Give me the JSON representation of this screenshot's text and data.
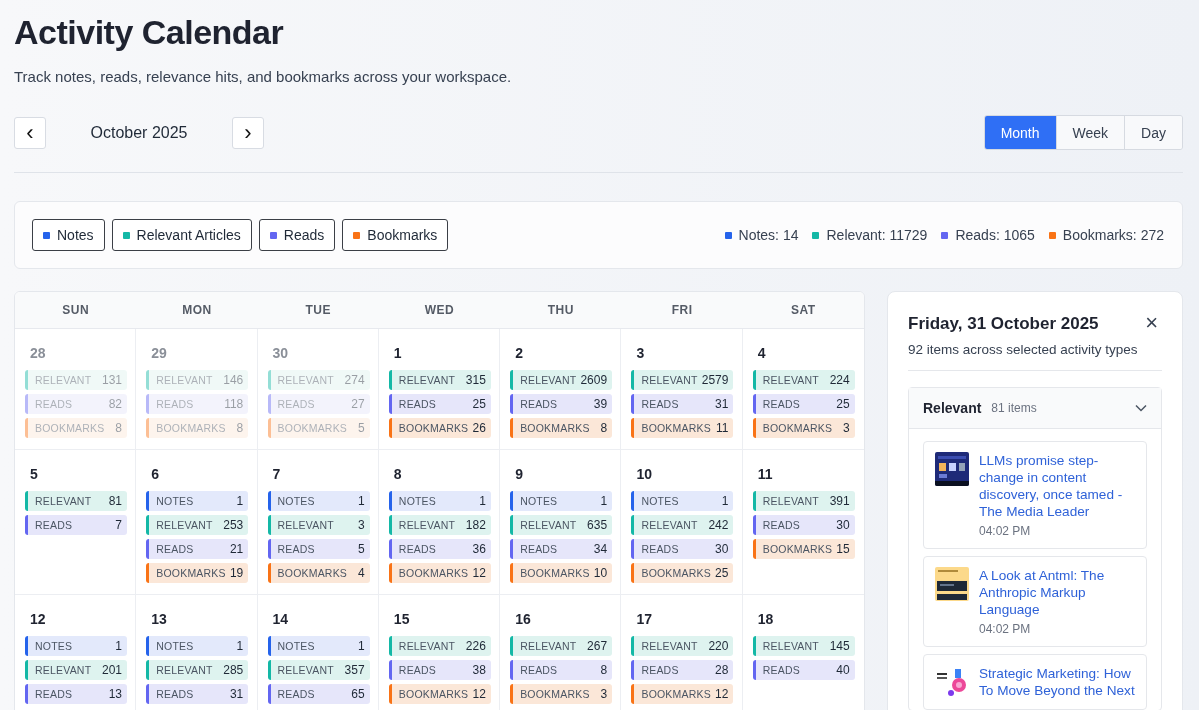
{
  "header": {
    "title": "Activity Calendar",
    "subtitle": "Track notes, reads, relevance hits, and bookmarks across your workspace."
  },
  "nav": {
    "prev": "‹",
    "month": "October 2025",
    "next": "›"
  },
  "views": [
    {
      "label": "Month",
      "selected": true
    },
    {
      "label": "Week",
      "selected": false
    },
    {
      "label": "Day",
      "selected": false
    }
  ],
  "filters": [
    {
      "label": "Notes",
      "color": "#2563eb"
    },
    {
      "label": "Relevant Articles",
      "color": "#14b8a6"
    },
    {
      "label": "Reads",
      "color": "#6366f1"
    },
    {
      "label": "Bookmarks",
      "color": "#f97316"
    }
  ],
  "totals": [
    {
      "label": "Notes: 14",
      "color": "#2563eb"
    },
    {
      "label": "Relevant: 11729",
      "color": "#14b8a6"
    },
    {
      "label": "Reads: 1065",
      "color": "#6366f1"
    },
    {
      "label": "Bookmarks: 272",
      "color": "#f97316"
    }
  ],
  "weekdays": [
    "SUN",
    "MON",
    "TUE",
    "WED",
    "THU",
    "FRI",
    "SAT"
  ],
  "weeks": [
    [
      {
        "day": "28",
        "outside": true,
        "items": [
          {
            "kind": "relevant",
            "label": "RELEVANT",
            "count": "131"
          },
          {
            "kind": "reads",
            "label": "READS",
            "count": "82"
          },
          {
            "kind": "bookmarks",
            "label": "BOOKMARKS",
            "count": "8"
          }
        ]
      },
      {
        "day": "29",
        "outside": true,
        "items": [
          {
            "kind": "relevant",
            "label": "RELEVANT",
            "count": "146"
          },
          {
            "kind": "reads",
            "label": "READS",
            "count": "118"
          },
          {
            "kind": "bookmarks",
            "label": "BOOKMARKS",
            "count": "8"
          }
        ]
      },
      {
        "day": "30",
        "outside": true,
        "items": [
          {
            "kind": "relevant",
            "label": "RELEVANT",
            "count": "274"
          },
          {
            "kind": "reads",
            "label": "READS",
            "count": "27"
          },
          {
            "kind": "bookmarks",
            "label": "BOOKMARKS",
            "count": "5"
          }
        ]
      },
      {
        "day": "1",
        "outside": false,
        "items": [
          {
            "kind": "relevant",
            "label": "RELEVANT",
            "count": "315"
          },
          {
            "kind": "reads",
            "label": "READS",
            "count": "25"
          },
          {
            "kind": "bookmarks",
            "label": "BOOKMARKS",
            "count": "26"
          }
        ]
      },
      {
        "day": "2",
        "outside": false,
        "items": [
          {
            "kind": "relevant",
            "label": "RELEVANT",
            "count": "2609"
          },
          {
            "kind": "reads",
            "label": "READS",
            "count": "39"
          },
          {
            "kind": "bookmarks",
            "label": "BOOKMARKS",
            "count": "8"
          }
        ]
      },
      {
        "day": "3",
        "outside": false,
        "items": [
          {
            "kind": "relevant",
            "label": "RELEVANT",
            "count": "2579"
          },
          {
            "kind": "reads",
            "label": "READS",
            "count": "31"
          },
          {
            "kind": "bookmarks",
            "label": "BOOKMARKS",
            "count": "11"
          }
        ]
      },
      {
        "day": "4",
        "outside": false,
        "items": [
          {
            "kind": "relevant",
            "label": "RELEVANT",
            "count": "224"
          },
          {
            "kind": "reads",
            "label": "READS",
            "count": "25"
          },
          {
            "kind": "bookmarks",
            "label": "BOOKMARKS",
            "count": "3"
          }
        ]
      }
    ],
    [
      {
        "day": "5",
        "outside": false,
        "items": [
          {
            "kind": "relevant",
            "label": "RELEVANT",
            "count": "81"
          },
          {
            "kind": "reads",
            "label": "READS",
            "count": "7"
          }
        ]
      },
      {
        "day": "6",
        "outside": false,
        "items": [
          {
            "kind": "notes",
            "label": "NOTES",
            "count": "1"
          },
          {
            "kind": "relevant",
            "label": "RELEVANT",
            "count": "253"
          },
          {
            "kind": "reads",
            "label": "READS",
            "count": "21"
          },
          {
            "kind": "bookmarks",
            "label": "BOOKMARKS",
            "count": "19"
          }
        ]
      },
      {
        "day": "7",
        "outside": false,
        "items": [
          {
            "kind": "notes",
            "label": "NOTES",
            "count": "1"
          },
          {
            "kind": "relevant",
            "label": "RELEVANT",
            "count": "3"
          },
          {
            "kind": "reads",
            "label": "READS",
            "count": "5"
          },
          {
            "kind": "bookmarks",
            "label": "BOOKMARKS",
            "count": "4"
          }
        ]
      },
      {
        "day": "8",
        "outside": false,
        "items": [
          {
            "kind": "notes",
            "label": "NOTES",
            "count": "1"
          },
          {
            "kind": "relevant",
            "label": "RELEVANT",
            "count": "182"
          },
          {
            "kind": "reads",
            "label": "READS",
            "count": "36"
          },
          {
            "kind": "bookmarks",
            "label": "BOOKMARKS",
            "count": "12"
          }
        ]
      },
      {
        "day": "9",
        "outside": false,
        "items": [
          {
            "kind": "notes",
            "label": "NOTES",
            "count": "1"
          },
          {
            "kind": "relevant",
            "label": "RELEVANT",
            "count": "635"
          },
          {
            "kind": "reads",
            "label": "READS",
            "count": "34"
          },
          {
            "kind": "bookmarks",
            "label": "BOOKMARKS",
            "count": "10"
          }
        ]
      },
      {
        "day": "10",
        "outside": false,
        "items": [
          {
            "kind": "notes",
            "label": "NOTES",
            "count": "1"
          },
          {
            "kind": "relevant",
            "label": "RELEVANT",
            "count": "242"
          },
          {
            "kind": "reads",
            "label": "READS",
            "count": "30"
          },
          {
            "kind": "bookmarks",
            "label": "BOOKMARKS",
            "count": "25"
          }
        ]
      },
      {
        "day": "11",
        "outside": false,
        "items": [
          {
            "kind": "relevant",
            "label": "RELEVANT",
            "count": "391"
          },
          {
            "kind": "reads",
            "label": "READS",
            "count": "30"
          },
          {
            "kind": "bookmarks",
            "label": "BOOKMARKS",
            "count": "15"
          }
        ]
      }
    ],
    [
      {
        "day": "12",
        "outside": false,
        "items": [
          {
            "kind": "notes",
            "label": "NOTES",
            "count": "1"
          },
          {
            "kind": "relevant",
            "label": "RELEVANT",
            "count": "201"
          },
          {
            "kind": "reads",
            "label": "READS",
            "count": "13"
          }
        ]
      },
      {
        "day": "13",
        "outside": false,
        "items": [
          {
            "kind": "notes",
            "label": "NOTES",
            "count": "1"
          },
          {
            "kind": "relevant",
            "label": "RELEVANT",
            "count": "285"
          },
          {
            "kind": "reads",
            "label": "READS",
            "count": "31"
          }
        ]
      },
      {
        "day": "14",
        "outside": false,
        "items": [
          {
            "kind": "notes",
            "label": "NOTES",
            "count": "1"
          },
          {
            "kind": "relevant",
            "label": "RELEVANT",
            "count": "357"
          },
          {
            "kind": "reads",
            "label": "READS",
            "count": "65"
          }
        ]
      },
      {
        "day": "15",
        "outside": false,
        "items": [
          {
            "kind": "relevant",
            "label": "RELEVANT",
            "count": "226"
          },
          {
            "kind": "reads",
            "label": "READS",
            "count": "38"
          },
          {
            "kind": "bookmarks",
            "label": "BOOKMARKS",
            "count": "12"
          }
        ]
      },
      {
        "day": "16",
        "outside": false,
        "items": [
          {
            "kind": "relevant",
            "label": "RELEVANT",
            "count": "267"
          },
          {
            "kind": "reads",
            "label": "READS",
            "count": "8"
          },
          {
            "kind": "bookmarks",
            "label": "BOOKMARKS",
            "count": "3"
          }
        ]
      },
      {
        "day": "17",
        "outside": false,
        "items": [
          {
            "kind": "relevant",
            "label": "RELEVANT",
            "count": "220"
          },
          {
            "kind": "reads",
            "label": "READS",
            "count": "28"
          },
          {
            "kind": "bookmarks",
            "label": "BOOKMARKS",
            "count": "12"
          }
        ]
      },
      {
        "day": "18",
        "outside": false,
        "items": [
          {
            "kind": "relevant",
            "label": "RELEVANT",
            "count": "145"
          },
          {
            "kind": "reads",
            "label": "READS",
            "count": "40"
          }
        ]
      }
    ]
  ],
  "panel": {
    "title": "Friday, 31 October 2025",
    "subtitle": "92 items across selected activity types",
    "close": "×",
    "group": {
      "name": "Relevant",
      "count": "81 items",
      "expanded": true,
      "articles": [
        {
          "title": "LLMs promise step-change in content discovery, once tamed - The Media Leader",
          "time": "04:02 PM",
          "kind": "picture"
        },
        {
          "title": "A Look at Antml: The Anthropic Markup Language",
          "time": "04:02 PM",
          "kind": "picture"
        },
        {
          "title": "Strategic Marketing: How To Move Beyond the Next",
          "kind": "picture"
        }
      ]
    }
  }
}
